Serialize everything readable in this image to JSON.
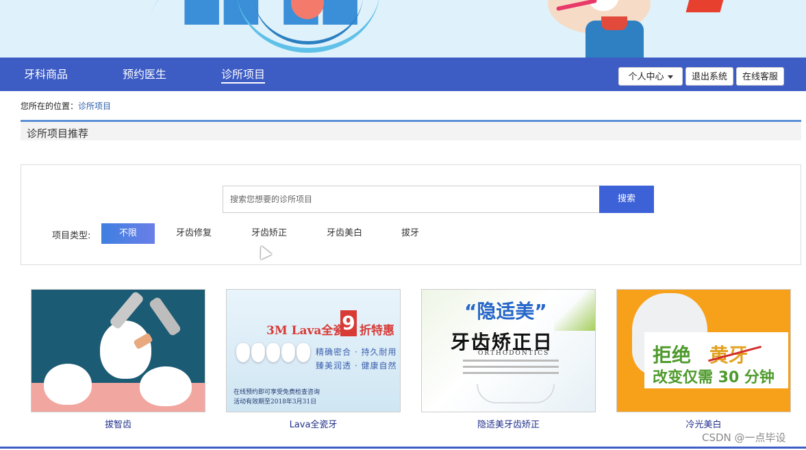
{
  "nav": {
    "items": [
      {
        "label": "牙科商品"
      },
      {
        "label": "预约医生"
      },
      {
        "label": "诊所项目",
        "active": true
      }
    ],
    "personal_center": "个人中心",
    "logout": "退出系统",
    "online_service": "在线客服"
  },
  "breadcrumb": {
    "prefix": "您所在的位置：",
    "current": "诊所项目"
  },
  "section": {
    "title": "诊所项目推荐"
  },
  "search": {
    "placeholder": "搜索您想要的诊所项目",
    "button": "搜索"
  },
  "filter": {
    "label": "项目类型:",
    "options": [
      "不限",
      "牙齿修复",
      "牙齿矫正",
      "牙齿美白",
      "拔牙"
    ],
    "selected": "不限"
  },
  "cards": [
    {
      "caption": "拔智齿"
    },
    {
      "caption": "Lava全瓷牙",
      "ad_title_a": "3M Lava全瓷冠",
      "ad_number": "9",
      "ad_title_b": "折特惠",
      "ad_line1": "精确密合 · 持久耐用",
      "ad_line2": "臻美润透 · 健康自然",
      "ad_note1": "在线预约即可享受免费检查咨询",
      "ad_note2": "活动有效期至2018年3月31日"
    },
    {
      "caption": "隐适美牙齿矫正",
      "ad_brand": "“隐适美”",
      "ad_title": "牙齿矫正日",
      "ad_sub": "ORTHODONTICS"
    },
    {
      "caption": "冷光美白",
      "ad_title_a": "拒绝",
      "ad_title_b": "黄牙",
      "ad_line": "改变仅需 30 分钟"
    }
  ],
  "watermark": "CSDN @一点毕设",
  "colors": {
    "nav_bg": "#3d5cc4",
    "accent": "#3d62d8",
    "caption": "#1f2f8a"
  }
}
